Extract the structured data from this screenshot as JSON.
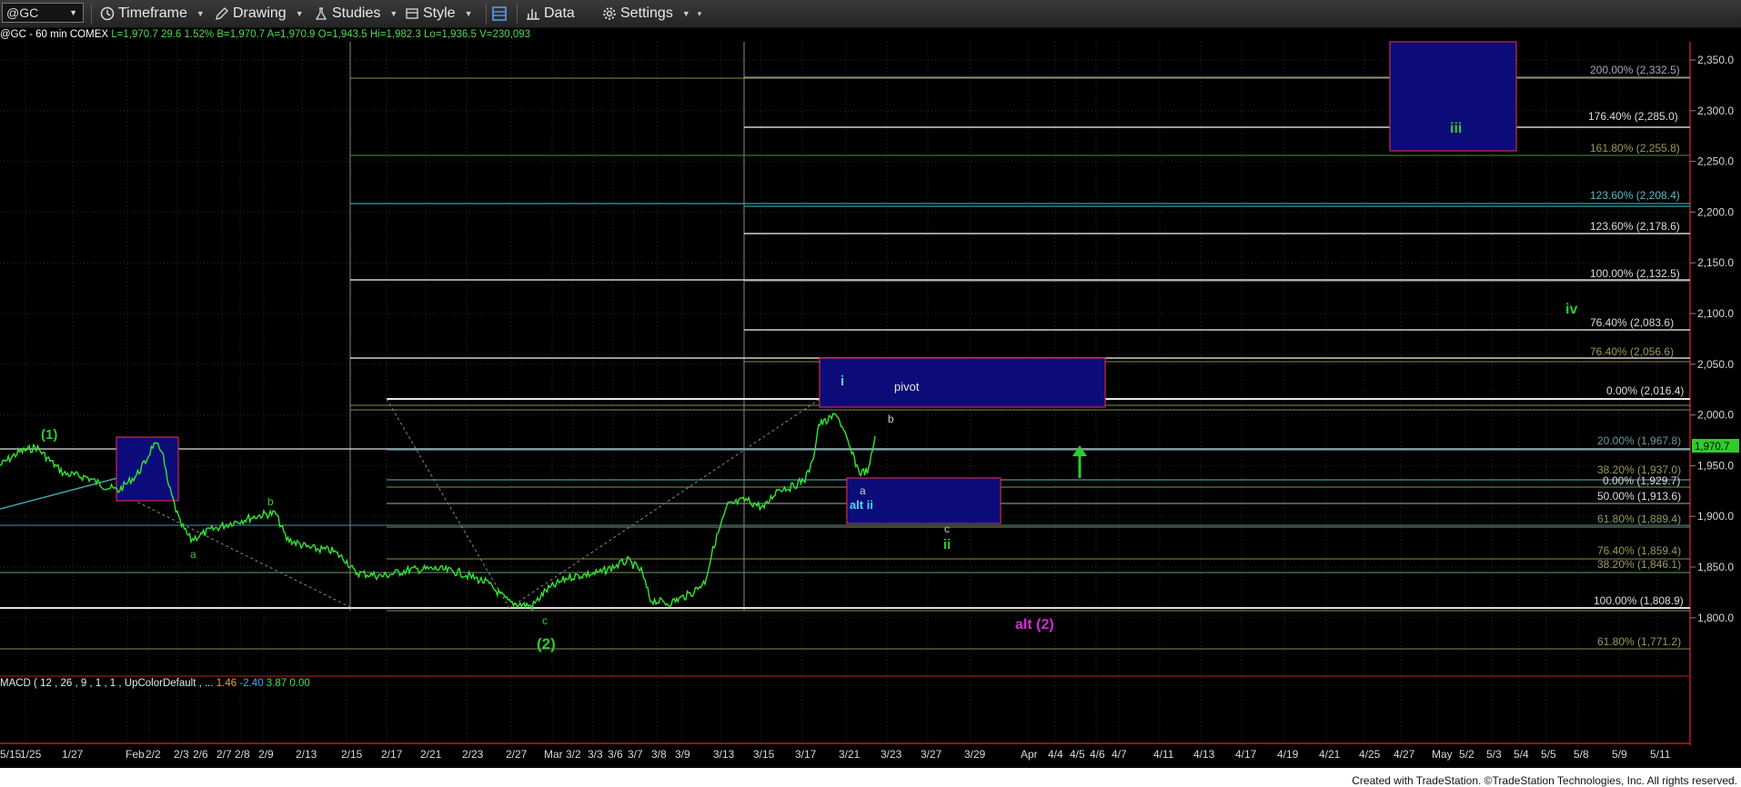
{
  "toolbar": {
    "symbol": "@GC",
    "timeframe": "Timeframe",
    "drawing": "Drawing",
    "studies": "Studies",
    "style": "Style",
    "data": "Data",
    "settings": "Settings"
  },
  "info": {
    "symbol": "@GC - 60 min",
    "exchange": "COMEX",
    "last": "L=1,970.7",
    "change": "29.6",
    "pct": "1.52%",
    "bid": "B=1,970.7",
    "ask": "A=1,970.9",
    "open": "O=1,943.5",
    "high": "Hi=1,982.3",
    "low": "Lo=1,936.5",
    "volume": "V=230,093"
  },
  "price_axis": {
    "ticks": [
      "2,350.0",
      "2,300.0",
      "2,250.0",
      "2,200.0",
      "2,150.0",
      "2,100.0",
      "2,050.0",
      "2,000.0",
      "1,950.0",
      "1,900.0",
      "1,850.0",
      "1,800.0"
    ],
    "current": "1,970.7"
  },
  "date_axis": [
    "1/25",
    "1/27",
    "Feb",
    "2/2",
    "2/3",
    "2/6",
    "2/7",
    "2/8",
    "2/9",
    "2/13",
    "2/15",
    "2/17",
    "2/21",
    "2/23",
    "2/27",
    "Mar",
    "3/2",
    "3/3",
    "3/6",
    "3/7",
    "3/8",
    "3/9",
    "3/13",
    "3/15",
    "3/17",
    "3/21",
    "3/23",
    "3/27",
    "3/29",
    "Apr",
    "4/4",
    "4/5",
    "4/6",
    "4/7",
    "4/11",
    "4/13",
    "4/17",
    "4/19",
    "4/21",
    "4/25",
    "4/27",
    "May",
    "5/2",
    "5/3",
    "5/4",
    "5/5",
    "5/8",
    "5/9",
    "5/11",
    "5/15"
  ],
  "fib_labels": [
    "200.00% (2,332.5)",
    "176.40% (2,285.0)",
    "161.80% (2,255.8)",
    "123.60% (2,208.4)",
    "123.60% (2,178.6)",
    "100.00% (2,132.5)",
    "76.40% (2,083.6)",
    "76.40% (2,056.6)",
    "0.00% (2,016.4)",
    "20.00% (1,967.8)",
    "38.20% (1,937.0)",
    "0.00% (1,929.7)",
    "50.00% (1,913.6)",
    "61.80% (1,889.4)",
    "76.40% (1,859.4)",
    "38.20% (1,846.1)",
    "100.00% (1,808.9)",
    "61.80% (1,771.2)"
  ],
  "wave_labels": {
    "w1": "(1)",
    "w2": "(2)",
    "a1": "a",
    "b1": "b",
    "c1": "c",
    "i": "i",
    "pivot": "pivot",
    "b2": "b",
    "a2": "a",
    "alt_ii": "alt ii",
    "c2": "c",
    "ii": "ii",
    "alt2": "alt (2)",
    "iii": "iii",
    "iv": "iv"
  },
  "macd": {
    "label": "MACD ( 12 , 26 , 9 , 1 , 1 , UpColorDefault , ...",
    "v1": "1.46",
    "v2": "-2.40",
    "v3": "3.87",
    "v4": "0.00"
  },
  "footer": "Created with TradeStation. ©TradeStation Technologies, Inc. All rights reserved.",
  "colors": {
    "price": "#32e632",
    "box_fill": "#0b0b7a",
    "box_border": "#d02a4a",
    "wave_green": "#2ecc2e",
    "wave_magenta": "#d42ad4",
    "wave_cyan": "#4fd8e8",
    "current_price_bg": "#2ecc2e"
  }
}
